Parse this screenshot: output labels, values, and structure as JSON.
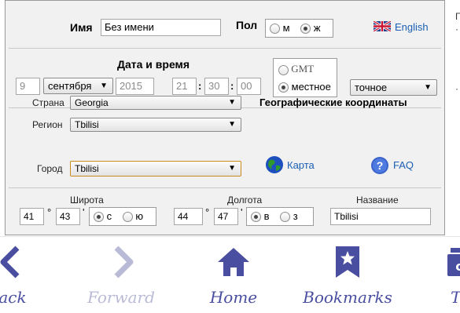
{
  "form": {
    "name_label": "Имя",
    "name_value": "Без имени",
    "sex_label": "Пол",
    "sex_options": [
      "м",
      "ж"
    ],
    "language_link": "English",
    "datetime_label": "Дата  и  время",
    "day": "9",
    "month": "сентября",
    "year": "2015",
    "hour": "21",
    "minute": "30",
    "second": "00",
    "time_modes": [
      "GMT",
      "местное"
    ],
    "precision": "точное",
    "country_label": "Страна",
    "country_value": "Georgia",
    "region_label": "Регион",
    "region_value": "Tbilisi",
    "city_label": "Город",
    "city_value": "Tbilisi",
    "geo_title": "Географические координаты",
    "map_link": "Карта",
    "faq_link": "FAQ",
    "lat_label": "Широта",
    "lat_deg": "41",
    "lat_min": "43",
    "lat_options": [
      "с",
      "ю"
    ],
    "lon_label": "Долгота",
    "lon_deg": "44",
    "lon_min": "47",
    "lon_options": [
      "в",
      "з"
    ],
    "place_label": "Название",
    "place_value": "Tbilisi",
    "degree_mark": "°",
    "minute_mark": "'"
  },
  "toolbar": {
    "back": "ack",
    "forward": "Forward",
    "home": "Home",
    "bookmarks": "Bookmarks",
    "tabs": "Ta"
  },
  "side": {
    "line1": "Г",
    "line2": "·",
    "line3": "·"
  },
  "colors": {
    "panel_bg": "#f1f1f1",
    "link": "#1a5fb4",
    "toolbar_icon": "#4a4ea0"
  }
}
